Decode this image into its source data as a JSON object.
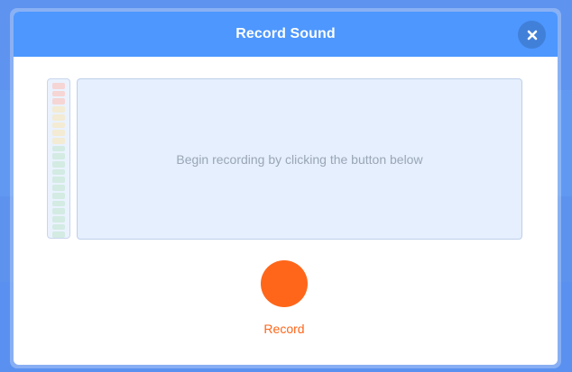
{
  "dialog": {
    "title": "Record Sound",
    "close_icon": "close-icon"
  },
  "waveform": {
    "hint": "Begin recording by clicking the button below"
  },
  "record": {
    "label": "Record",
    "color": "#ff661a"
  },
  "colors": {
    "header": "#4d97ff",
    "meter_red": "#f6d5d5",
    "meter_yellow": "#f3ebd3",
    "meter_green": "#d3ebe3"
  },
  "level_meter": {
    "level": 0,
    "segments": [
      "red",
      "red",
      "red",
      "yellow",
      "yellow",
      "yellow",
      "yellow",
      "yellow",
      "green",
      "green",
      "green",
      "green",
      "green",
      "green",
      "green",
      "green",
      "green",
      "green",
      "green",
      "green"
    ]
  }
}
